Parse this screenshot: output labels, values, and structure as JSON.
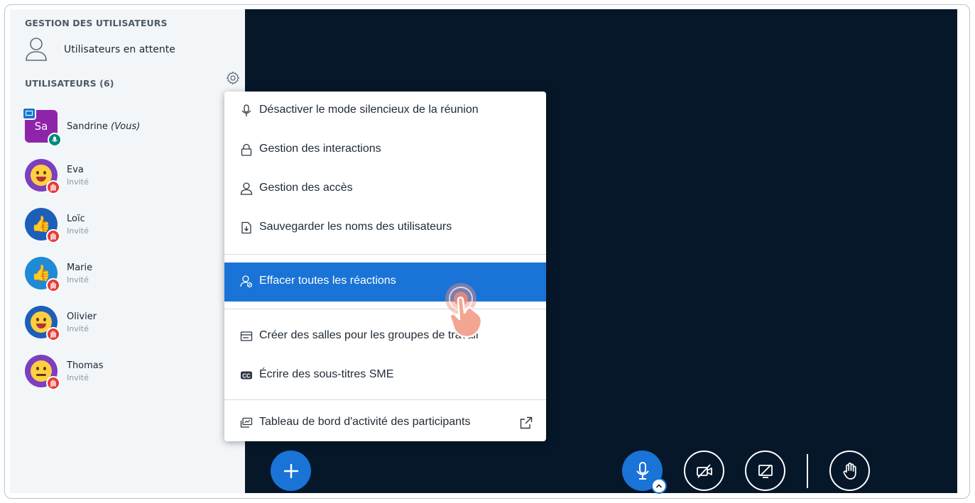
{
  "sidebar": {
    "user_management_title": "GESTION DES UTILISATEURS",
    "waiting_users_label": "Utilisateurs en attente",
    "users_title": "UTILISATEURS (6)",
    "users": [
      {
        "name": "Sandrine",
        "you_suffix": "(Vous)",
        "initials": "Sa",
        "role": ""
      },
      {
        "name": "Eva",
        "role": "Invité"
      },
      {
        "name": "Loïc",
        "role": "Invité"
      },
      {
        "name": "Marie",
        "role": "Invité"
      },
      {
        "name": "Olivier",
        "role": "Invité"
      },
      {
        "name": "Thomas",
        "role": "Invité"
      }
    ]
  },
  "menu": {
    "items": [
      {
        "label": "Désactiver le mode silencieux de la réunion",
        "icon": "mic-icon"
      },
      {
        "label": "Gestion des interactions",
        "icon": "lock-icon"
      },
      {
        "label": "Gestion des accès",
        "icon": "user-icon"
      },
      {
        "label": "Sauvegarder les noms des utilisateurs",
        "icon": "download-file-icon"
      },
      {
        "label": "Effacer toutes les réactions",
        "icon": "clear-reactions-icon",
        "active": true
      },
      {
        "label": "Créer des salles pour les groupes de travail",
        "icon": "breakout-rooms-icon"
      },
      {
        "label": "Écrire des sous-titres SME",
        "icon": "closed-captions-icon"
      },
      {
        "label": "Tableau de bord d'activité des participants",
        "icon": "dashboard-icon"
      }
    ]
  },
  "colors": {
    "accent": "#1a73d6",
    "main_bg": "#06172a",
    "sidebar_bg": "#f3f6f9",
    "presenter_avatar": "#8e24aa",
    "hand_badge": "#e53935",
    "mic_badge": "#00897b"
  }
}
